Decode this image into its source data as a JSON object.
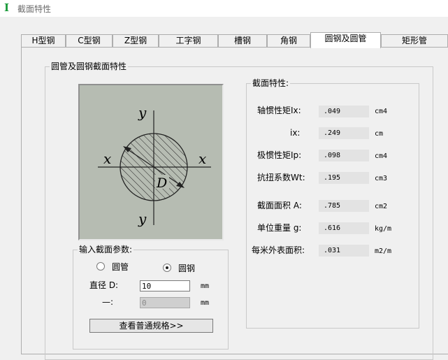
{
  "window": {
    "title": "截面特性"
  },
  "tabs": [
    {
      "label": "H型钢"
    },
    {
      "label": "C型钢"
    },
    {
      "label": "Z型钢"
    },
    {
      "label": "工字钢"
    },
    {
      "label": "槽钢"
    },
    {
      "label": "角钢"
    },
    {
      "label": "圆钢及圆管"
    },
    {
      "label": "矩形管"
    }
  ],
  "section_group": {
    "title": "圆管及圆钢截面特性"
  },
  "diagram": {
    "x_label": "x",
    "y_label": "y",
    "d_label": "D"
  },
  "properties": {
    "title": "截面特性:",
    "items": [
      {
        "label": "轴惯性矩Ix:",
        "value": ".049",
        "unit": "cm4"
      },
      {
        "label": "ix:",
        "value": ".249",
        "unit": "cm"
      },
      {
        "label": "极惯性矩Ip:",
        "value": ".098",
        "unit": "cm4"
      },
      {
        "label": "抗扭系数Wt:",
        "value": ".195",
        "unit": "cm3"
      },
      {
        "label": "截面面积 A:",
        "value": ".785",
        "unit": "cm2"
      },
      {
        "label": "单位重量 g:",
        "value": ".616",
        "unit": "kg/m"
      },
      {
        "label": "每米外表面积:",
        "value": ".031",
        "unit": "m2/m"
      }
    ]
  },
  "input_group": {
    "title": "输入截面参数:",
    "radio_pipe": "圆管",
    "radio_bar": "圆钢",
    "selected": "圆钢",
    "diameter_label": "直径 D:",
    "diameter_value": "10",
    "diameter_unit": "mm",
    "thickness_label": "—:",
    "thickness_value": "0",
    "thickness_unit": "mm",
    "button_label": "查看普通规格>>"
  },
  "colors": {
    "diagram_bg": "#b6bcb2",
    "app_icon": "#1a9a3a"
  }
}
